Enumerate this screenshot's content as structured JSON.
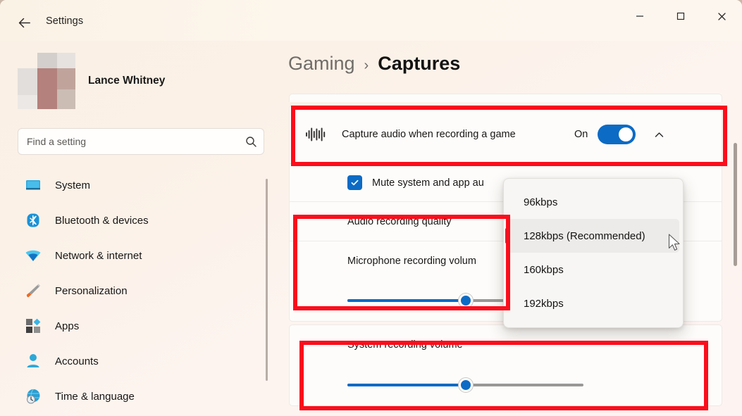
{
  "window": {
    "title": "Settings",
    "back_icon": "back-arrow-icon",
    "minimize_label": "–",
    "maximize_label": "☐",
    "close_label": "✕"
  },
  "sidebar": {
    "account_name": "Lance Whitney",
    "search": {
      "placeholder": "Find a setting",
      "value": "",
      "icon": "search-icon"
    },
    "items": [
      {
        "label": "System",
        "icon": "monitor-icon"
      },
      {
        "label": "Bluetooth & devices",
        "icon": "bluetooth-icon"
      },
      {
        "label": "Network & internet",
        "icon": "wifi-icon"
      },
      {
        "label": "Personalization",
        "icon": "paintbrush-icon"
      },
      {
        "label": "Apps",
        "icon": "apps-grid-icon"
      },
      {
        "label": "Accounts",
        "icon": "person-icon"
      },
      {
        "label": "Time & language",
        "icon": "clock-globe-icon"
      }
    ]
  },
  "breadcrumb": {
    "parent": "Gaming",
    "separator": "›",
    "current": "Captures"
  },
  "main": {
    "capture_audio": {
      "icon": "audio-waveform-icon",
      "label": "Capture audio when recording a game",
      "toggle_state_text": "On",
      "toggle_on": true,
      "expand_icon": "chevron-up-icon"
    },
    "mute_row": {
      "label": "Mute system and app au",
      "checked": true,
      "check_icon": "checkmark-icon"
    },
    "audio_quality_row": {
      "label": "Audio recording quality"
    },
    "mic_volume_row": {
      "label": "Microphone recording volum"
    },
    "mic_slider": {
      "value": 50
    },
    "system_volume_row": {
      "label": "System recording volume"
    },
    "system_slider": {
      "value": 50
    }
  },
  "dropdown": {
    "options": [
      {
        "label": "96kbps",
        "selected": false
      },
      {
        "label": "128kbps (Recommended)",
        "selected": true
      },
      {
        "label": "160kbps",
        "selected": false
      },
      {
        "label": "192kbps",
        "selected": false
      }
    ]
  },
  "colors": {
    "accent_blue": "#0c6bc4",
    "annotation_red": "#fc0d1b",
    "background_cream": "#fbf2e6"
  }
}
